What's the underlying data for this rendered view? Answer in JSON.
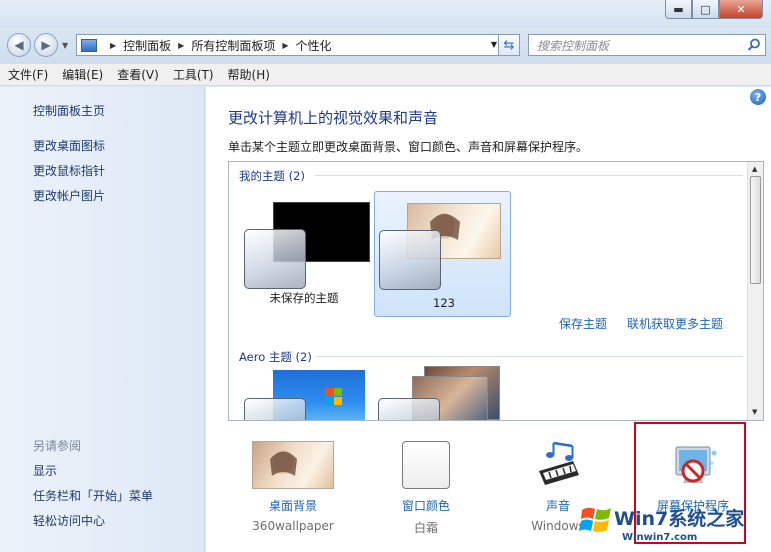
{
  "window": {
    "controls": {
      "minimize": "▬",
      "maximize": "□",
      "close": "✕"
    }
  },
  "address": {
    "breadcrumbs": [
      "控制面板",
      "所有控制面板项",
      "个性化"
    ],
    "search_placeholder": "搜索控制面板"
  },
  "menu": [
    "文件(F)",
    "编辑(E)",
    "查看(V)",
    "工具(T)",
    "帮助(H)"
  ],
  "sidebar": {
    "home": "控制面板主页",
    "links": [
      "更改桌面图标",
      "更改鼠标指针",
      "更改帐户图片"
    ],
    "see_also_title": "另请参阅",
    "see_also": [
      "显示",
      "任务栏和「开始」菜单",
      "轻松访问中心"
    ]
  },
  "main": {
    "help": "?",
    "heading": "更改计算机上的视觉效果和声音",
    "subtitle": "单击某个主题立即更改桌面背景、窗口颜色、声音和屏幕保护程序。",
    "my_themes_header": "我的主题 (2)",
    "themes": [
      {
        "label": "未保存的主题"
      },
      {
        "label": "123"
      }
    ],
    "save_theme": "保存主题",
    "get_more": "联机获取更多主题",
    "aero_header": "Aero 主题 (2)"
  },
  "bottom": [
    {
      "label": "桌面背景",
      "sub": "360wallpaper"
    },
    {
      "label": "窗口颜色",
      "sub": "白霜"
    },
    {
      "label": "声音",
      "sub": "Windows"
    },
    {
      "label": "屏幕保护程序",
      "sub": ""
    }
  ],
  "watermark": {
    "text": "Win7系统之家",
    "url": "Winwin7.com"
  },
  "colors": {
    "link": "#1e63b5",
    "heading": "#1e3a8a",
    "highlight": "#d0021b"
  }
}
